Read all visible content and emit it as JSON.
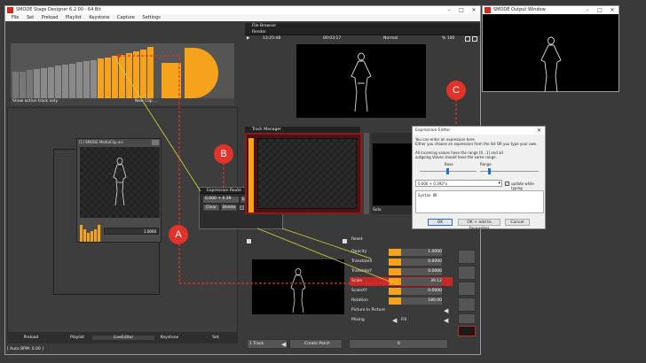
{
  "designer": {
    "title": "SMODE Stage Designer 6.2.00 - 64 Bit",
    "menu": [
      "File",
      "Set",
      "Preload",
      "Playlist",
      "Keystone",
      "Capture",
      "Settings"
    ],
    "show_active_track": "Show active track only",
    "new_clip": "New Clip ...",
    "bottom_tabs": [
      "Preload",
      "Playlist",
      "LiveEditor",
      "Keystone",
      "Set"
    ],
    "status": "[ Auto BPM: 0.00 ]"
  },
  "output_window": {
    "title": "SMODE Output Window"
  },
  "clip_window": {
    "title": "[1] SMODE MediaClip.avi",
    "value": "1.0000"
  },
  "file_browser": {
    "label": "File Browser"
  },
  "render": {
    "label": "Render",
    "time_left": "13:25:48",
    "time_mid": "00:03:17",
    "mode": "Normal",
    "percent": "% 100"
  },
  "track_manager": {
    "label": "Track Manager",
    "sub_label": "Solo"
  },
  "expression_route": {
    "label": "Expression Route",
    "expression": "0.000 + 0.39",
    "edit": "Edit",
    "clear": "Clear",
    "delete": "Delete",
    "pause": "Pause"
  },
  "expression_editor": {
    "title": "Expression Editor",
    "line1": "You can enter an expression here.",
    "line2": "Either you choose an expression from the list OR you type your own.",
    "line3": "All incoming values have the range [0...1] and all",
    "line4": "outgoing Values should have the same range.",
    "base": "Base",
    "range": "Range",
    "expression_value": "0.000 + 0.392*x",
    "update_label": "update while typing",
    "syntax": "Syntax OK",
    "ok": "OK",
    "ok_add": "OK + add to favourites",
    "cancel": "Cancel"
  },
  "properties": {
    "reset": "Reset",
    "rows": [
      {
        "label": "Opacity",
        "value": "1.0000"
      },
      {
        "label": "TranslateX",
        "value": "0.0000"
      },
      {
        "label": "TranslateY",
        "value": "0.0000"
      },
      {
        "label": "Scale",
        "value": "39.12"
      },
      {
        "label": "ScaleXY",
        "value": "0.0000"
      },
      {
        "label": "Rotation",
        "value": "180.00"
      }
    ],
    "pip": "Picture In Picture",
    "mixing": "Mixing",
    "mixing_value": "Fill"
  },
  "bottom_bar": {
    "track": "1 Track",
    "create_patch": "Create Patch",
    "count": "6"
  },
  "callouts": {
    "a": "A",
    "b": "B",
    "c": "C"
  },
  "colors": {
    "accent": "#f6a21d",
    "callout": "#e0332a",
    "highlight": "#c62828"
  },
  "clip_bar_levels": [
    0.49,
    0.49,
    0.51,
    0.53,
    0.55,
    0.57,
    0.59,
    0.61,
    0.63,
    0.66,
    0.68,
    0.7,
    0.72,
    0.74,
    0.77,
    0.79,
    0.82,
    0.85,
    0.89,
    0.93
  ],
  "clip_mini_levels": [
    0.8,
    0.6,
    0.4,
    0.5,
    0.6,
    0.8
  ]
}
